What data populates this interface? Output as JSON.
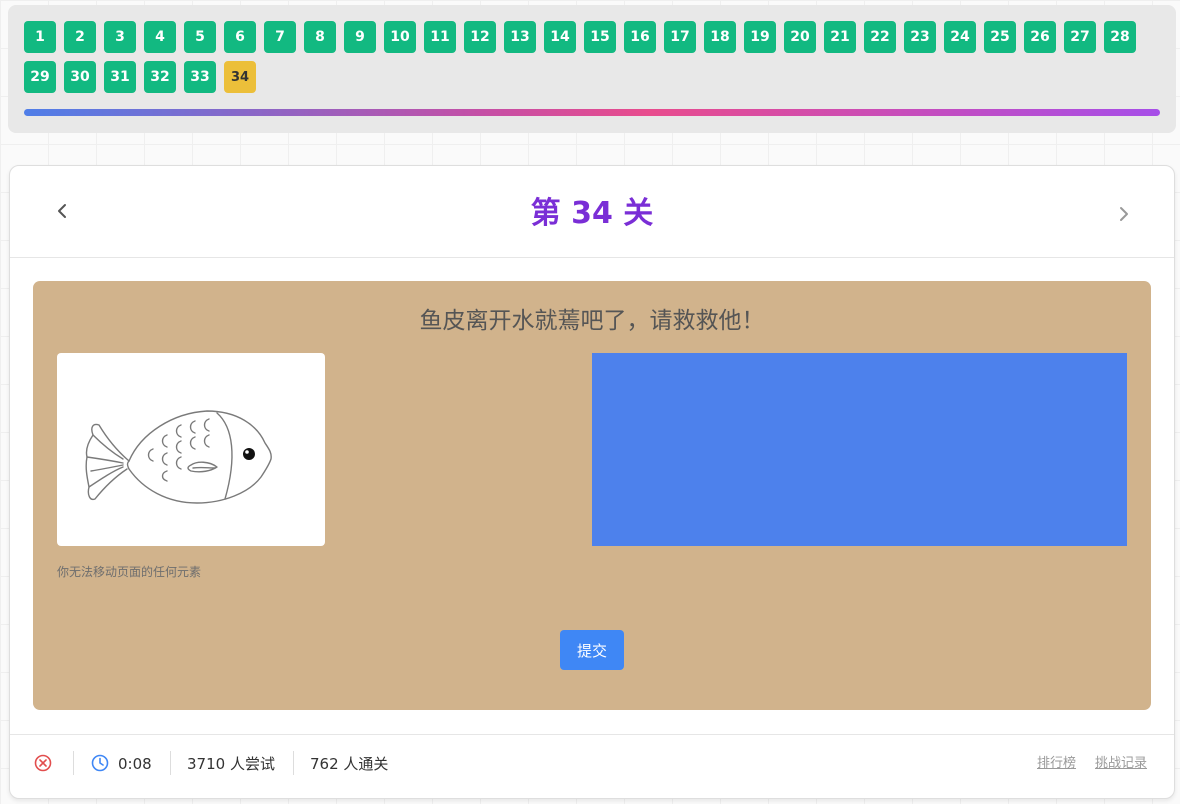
{
  "levels": {
    "items": [
      "1",
      "2",
      "3",
      "4",
      "5",
      "6",
      "7",
      "8",
      "9",
      "10",
      "11",
      "12",
      "13",
      "14",
      "15",
      "16",
      "17",
      "18",
      "19",
      "20",
      "21",
      "22",
      "23",
      "24",
      "25",
      "26",
      "27",
      "28",
      "29",
      "30",
      "31",
      "32",
      "33",
      "34"
    ],
    "completed_color": "#12b981",
    "current": "34",
    "current_color": "#ecbf3a"
  },
  "header": {
    "title": "第 34 关",
    "prev_icon": "chevron-left-icon",
    "next_icon": "chevron-right-icon",
    "title_color": "#7a2ed6"
  },
  "puzzle": {
    "prompt": "鱼皮离开水就蔫吧了，请救救他！",
    "hint": "你无法移动页面的任何元素",
    "submit_label": "提交",
    "fish_icon": "fish-drawing",
    "water_color": "#4d81ec",
    "stage_color": "#d1b38c"
  },
  "footer": {
    "status_icon": "close-circle-icon",
    "timer_icon": "clock-icon",
    "timer": "0:08",
    "attempts": "3710 人尝试",
    "passed": "762 人通关",
    "leaderboard_label": "排行榜",
    "history_label": "挑战记录"
  }
}
